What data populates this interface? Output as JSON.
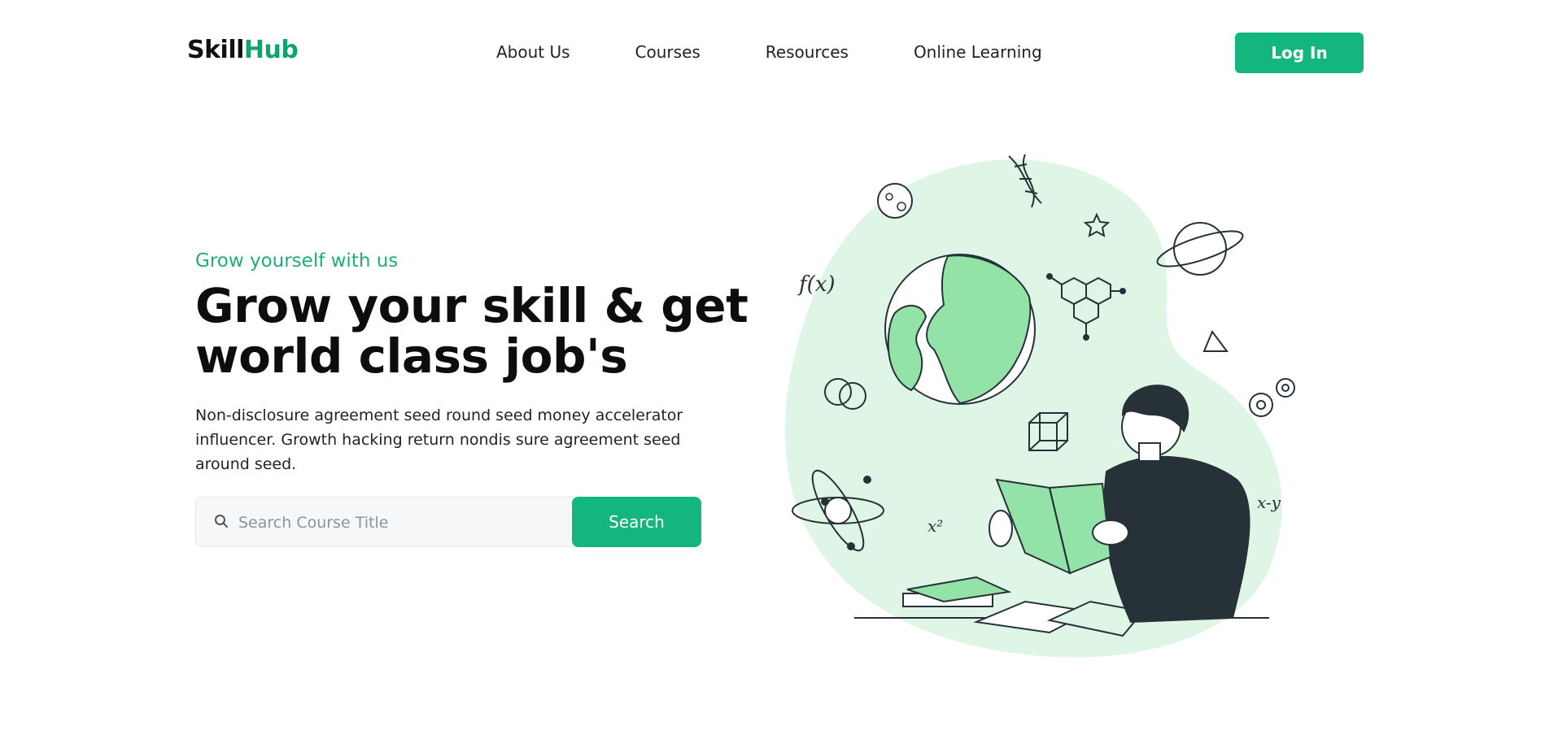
{
  "brand": {
    "part1": "Skill",
    "part2": "Hub"
  },
  "nav": {
    "items": [
      "About Us",
      "Courses",
      "Resources",
      "Online Learning"
    ],
    "login_label": "Log In"
  },
  "hero": {
    "eyebrow": "Grow yourself with us",
    "headline": "Grow your skill & get world class job's",
    "description": "Non-disclosure agreement seed round seed money accelerator influencer. Growth hacking return nondis sure agreement seed around seed.",
    "search": {
      "placeholder": "Search Course Title",
      "button_label": "Search"
    }
  },
  "illustration": {
    "labels": {
      "fx": "f(x)",
      "x2": "x²",
      "xy": "x-y"
    }
  },
  "colors": {
    "accent": "#13b77d",
    "blob": "#dff6e6",
    "leaf": "#93e3a8",
    "ink": "#263238"
  }
}
